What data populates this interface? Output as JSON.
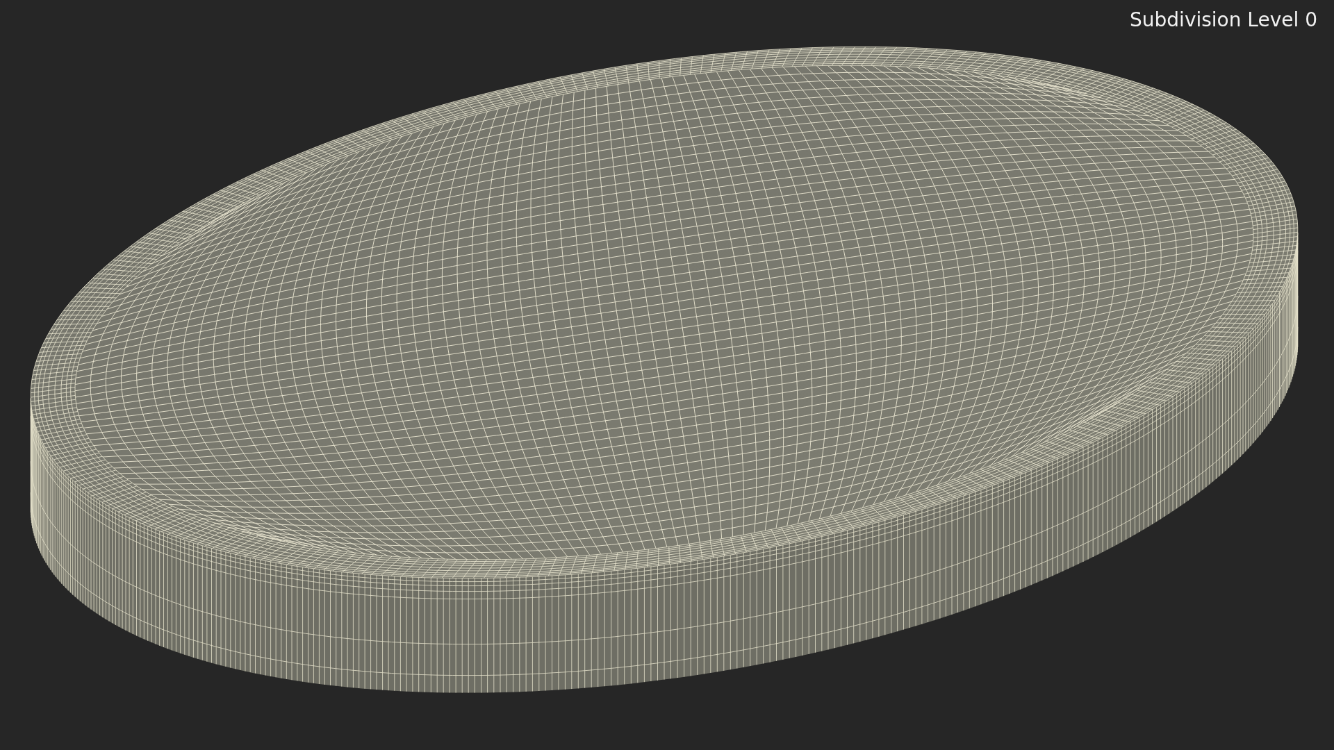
{
  "viewport": {
    "label": "Subdivision Level 0"
  }
}
